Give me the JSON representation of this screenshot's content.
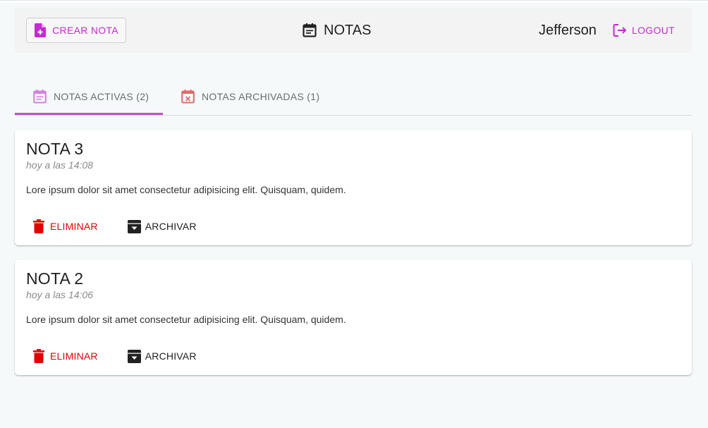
{
  "header": {
    "create_button_label": "CREAR NOTA",
    "title": "NOTAS",
    "username": "Jefferson",
    "logout_label": "LOGOUT"
  },
  "tabs": [
    {
      "label": "NOTAS ACTIVAS (2)",
      "icon": "calendar-notes-icon",
      "active": true
    },
    {
      "label": "NOTAS ARCHIVADAS (1)",
      "icon": "calendar-remove-icon",
      "active": false
    }
  ],
  "notes": [
    {
      "title": "NOTA 3",
      "date": "hoy a las 14:08",
      "content": "Lore ipsum dolor sit amet consectetur adipisicing elit. Quisquam, quidem.",
      "delete_label": "ELIMINAR",
      "archive_label": "ARCHIVAR"
    },
    {
      "title": "NOTA 2",
      "date": "hoy a las 14:06",
      "content": "Lore ipsum dolor sit amet consectetur adipisicing elit. Quisquam, quidem.",
      "delete_label": "ELIMINAR",
      "archive_label": "ARCHIVAR"
    }
  ],
  "colors": {
    "accent": "#c42bd0",
    "danger": "#e50000",
    "tab_indicator": "#c04fcf",
    "archived_tab_icon": "#e06a6a"
  }
}
